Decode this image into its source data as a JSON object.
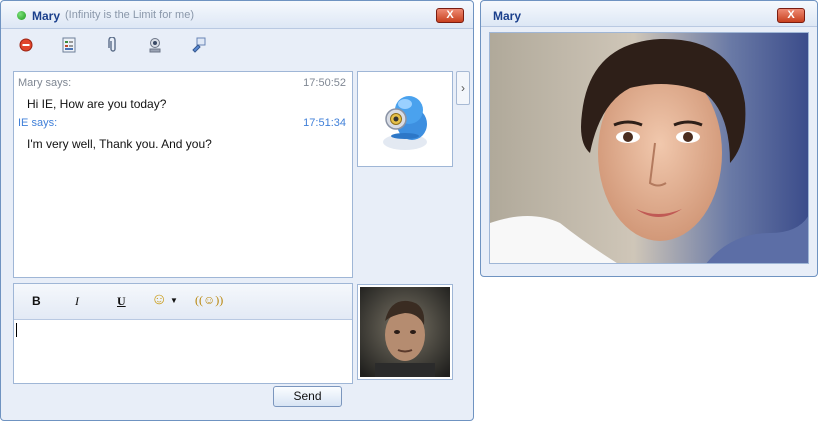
{
  "chat_window": {
    "contact_name": "Mary",
    "status_message": "(Infinity is the Limit for me)",
    "close_label": "X"
  },
  "toolbar": {
    "icons": [
      "block-icon",
      "contact-card-icon",
      "attach-icon",
      "webcam-icon",
      "share-icon"
    ]
  },
  "conversation": [
    {
      "sender": "Mary says:",
      "time": "17:50:52",
      "text": "Hi IE, How are you today?"
    },
    {
      "sender": "IE says:",
      "time": "17:51:34",
      "text": "I'm very well, Thank you. And you?"
    }
  ],
  "format_bar": {
    "bold": "B",
    "italic": "I",
    "underline": "U",
    "emoticon": "☺",
    "nudge": "((☺))"
  },
  "compose": {
    "value": ""
  },
  "send_label": "Send",
  "expand_label": "›",
  "side_window": {
    "title": "Mary",
    "close_label": "X"
  },
  "colors": {
    "sender_color": "#7f8793",
    "self_sender_color": "#3f7fd8",
    "title_color": "#1a3f8c",
    "window_bg": "#e8eef8"
  }
}
